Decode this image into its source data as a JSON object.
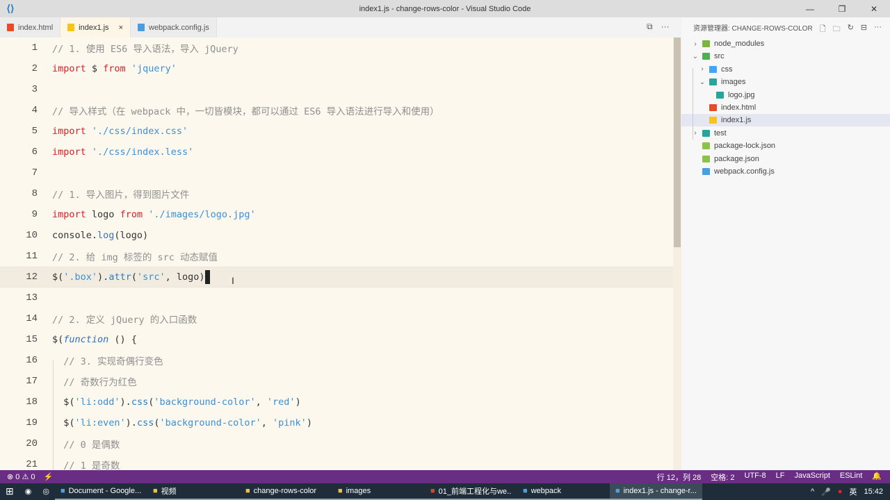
{
  "window": {
    "title": "index1.js - change-rows-color - Visual Studio Code",
    "controls": [
      "—",
      "❐",
      "✕"
    ]
  },
  "tabs": [
    {
      "label": "index.html",
      "icon": "html-file-icon",
      "color": "#e44d26"
    },
    {
      "label": "index1.js",
      "icon": "js-file-icon",
      "color": "#f5c518",
      "active": true,
      "close": "×"
    },
    {
      "label": "webpack.config.js",
      "icon": "webpack-icon",
      "color": "#4a9ee0"
    }
  ],
  "tab_actions": [
    "⧉",
    "···"
  ],
  "code": [
    [
      [
        "// 1. 使用 ES6 导入语法，导入 jQuery",
        "c"
      ]
    ],
    [
      [
        "import",
        "k"
      ],
      [
        " $ ",
        ""
      ],
      [
        "from",
        "k"
      ],
      [
        " ",
        ""
      ],
      [
        "'jquery'",
        "s"
      ]
    ],
    [],
    [
      [
        "// 导入样式（在 webpack 中，一切皆模块，都可以通过 ES6 导入语法进行导入和使用）",
        "c"
      ]
    ],
    [
      [
        "import",
        "k"
      ],
      [
        " ",
        ""
      ],
      [
        "'./css/index.css'",
        "s"
      ]
    ],
    [
      [
        "import",
        "k"
      ],
      [
        " ",
        ""
      ],
      [
        "'./css/index.less'",
        "s"
      ]
    ],
    [],
    [
      [
        "// 1. 导入图片，得到图片文件",
        "c"
      ]
    ],
    [
      [
        "import",
        "k"
      ],
      [
        " logo ",
        ""
      ],
      [
        "from",
        "k"
      ],
      [
        " ",
        ""
      ],
      [
        "'./images/logo.jpg'",
        "s"
      ]
    ],
    [
      [
        "console.",
        ""
      ],
      [
        "log",
        "f"
      ],
      [
        "(logo)",
        ""
      ]
    ],
    [
      [
        "// 2. 给 img 标签的 src 动态赋值",
        "c"
      ]
    ],
    [
      [
        "$(",
        ""
      ],
      [
        "'.box'",
        "s"
      ],
      [
        ").",
        ""
      ],
      [
        "attr",
        "f"
      ],
      [
        "(",
        ""
      ],
      [
        "'src'",
        "s"
      ],
      [
        ", logo)",
        ""
      ]
    ],
    [],
    [
      [
        "// 2. 定义 jQuery 的入口函数",
        "c"
      ]
    ],
    [
      [
        "$(",
        ""
      ],
      [
        "function",
        "i"
      ],
      [
        " () {",
        ""
      ]
    ],
    [
      [
        "  ",
        ""
      ],
      [
        "// 3. 实现奇偶行变色",
        "c"
      ]
    ],
    [
      [
        "  ",
        ""
      ],
      [
        "// 奇数行为红色",
        "c"
      ]
    ],
    [
      [
        "  $(",
        ""
      ],
      [
        "'li:odd'",
        "s"
      ],
      [
        ").",
        ""
      ],
      [
        "css",
        "f"
      ],
      [
        "(",
        ""
      ],
      [
        "'background-color'",
        "s"
      ],
      [
        ", ",
        ""
      ],
      [
        "'red'",
        "s"
      ],
      [
        ")",
        ""
      ]
    ],
    [
      [
        "  $(",
        ""
      ],
      [
        "'li:even'",
        "s"
      ],
      [
        ").",
        ""
      ],
      [
        "css",
        "f"
      ],
      [
        "(",
        ""
      ],
      [
        "'background-color'",
        "s"
      ],
      [
        ", ",
        ""
      ],
      [
        "'pink'",
        "s"
      ],
      [
        ")",
        ""
      ]
    ],
    [
      [
        "  ",
        ""
      ],
      [
        "// 0 是偶数",
        "c"
      ]
    ],
    [
      [
        "  ",
        ""
      ],
      [
        "// 1 是奇数",
        "c"
      ]
    ]
  ],
  "cursor_line": 12,
  "explorer": {
    "title": "资源管理器: CHANGE-ROWS-COLOR",
    "actions": [
      "new-file",
      "new-folder",
      "refresh",
      "collapse",
      "more"
    ],
    "items": [
      {
        "label": "node_modules",
        "depth": 0,
        "chev": ">",
        "color": "#7cb342"
      },
      {
        "label": "src",
        "depth": 0,
        "chev": "v",
        "color": "#4caf50"
      },
      {
        "label": "css",
        "depth": 1,
        "chev": ">",
        "color": "#42a5f5"
      },
      {
        "label": "images",
        "depth": 1,
        "chev": "v",
        "color": "#26a69a"
      },
      {
        "label": "logo.jpg",
        "depth": 2,
        "chev": "",
        "color": "#26a69a"
      },
      {
        "label": "index.html",
        "depth": 1,
        "chev": "",
        "color": "#e44d26"
      },
      {
        "label": "index1.js",
        "depth": 1,
        "chev": "",
        "color": "#f5c518",
        "selected": true
      },
      {
        "label": "test",
        "depth": 0,
        "chev": ">",
        "color": "#26a69a"
      },
      {
        "label": "package-lock.json",
        "depth": 0,
        "chev": "",
        "color": "#8bc34a"
      },
      {
        "label": "package.json",
        "depth": 0,
        "chev": "",
        "color": "#8bc34a"
      },
      {
        "label": "webpack.config.js",
        "depth": 0,
        "chev": "",
        "color": "#4a9ee0"
      }
    ]
  },
  "status": {
    "errors": "⊗ 0 ⚠ 0",
    "sync": "⚡",
    "position": "行 12，列 28",
    "spaces": "空格: 2",
    "encoding": "UTF-8",
    "eol": "LF",
    "language": "JavaScript",
    "extra": "ESLint",
    "bell": "🔔"
  },
  "taskbar": {
    "items": [
      {
        "label": "Document - Google...",
        "icon": "chrome-icon"
      },
      {
        "label": "视频",
        "icon": "folder-icon"
      },
      {
        "label": "change-rows-color",
        "icon": "folder-icon"
      },
      {
        "label": "images",
        "icon": "folder-icon"
      },
      {
        "label": "01_前端工程化与we...",
        "icon": "powerpoint-icon"
      },
      {
        "label": "webpack",
        "icon": "terminal-icon"
      },
      {
        "label": "index1.js - change-r...",
        "icon": "vscode-icon",
        "active": true
      }
    ],
    "ime": "英",
    "time": "15:42"
  }
}
